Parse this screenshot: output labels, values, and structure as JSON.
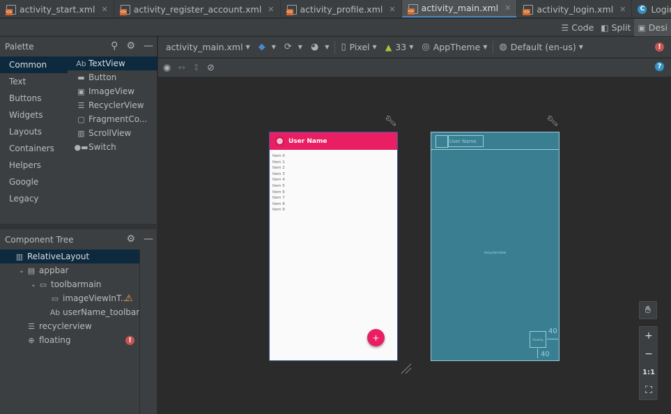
{
  "tabs": [
    {
      "label": "activity_start.xml",
      "type": "xml",
      "active": false
    },
    {
      "label": "activity_register_account.xml",
      "type": "xml",
      "active": false
    },
    {
      "label": "activity_profile.xml",
      "type": "xml",
      "active": false
    },
    {
      "label": "activity_main.xml",
      "type": "xml",
      "active": true
    },
    {
      "label": "activity_login.xml",
      "type": "xml",
      "active": false
    },
    {
      "label": "LoginActivity.java",
      "type": "java",
      "active": false
    }
  ],
  "modes": {
    "code": "Code",
    "split": "Split",
    "design": "Desi"
  },
  "palette": {
    "title": "Palette",
    "categories": [
      "Common",
      "Text",
      "Buttons",
      "Widgets",
      "Layouts",
      "Containers",
      "Helpers",
      "Google",
      "Legacy"
    ],
    "items": [
      {
        "label": "TextView",
        "icon": "Ab"
      },
      {
        "label": "Button",
        "icon": "▬"
      },
      {
        "label": "ImageView",
        "icon": "▣"
      },
      {
        "label": "RecyclerView",
        "icon": "☰"
      },
      {
        "label": "FragmentCo...",
        "icon": "▢"
      },
      {
        "label": "ScrollView",
        "icon": "▥"
      },
      {
        "label": "Switch",
        "icon": "●▬"
      }
    ]
  },
  "component_tree": {
    "title": "Component Tree",
    "items": [
      {
        "label": "RelativeLayout",
        "indent": 0,
        "chev": "",
        "icon": "▥",
        "status": ""
      },
      {
        "label": "appbar",
        "indent": 1,
        "chev": "⌄",
        "icon": "▤",
        "status": ""
      },
      {
        "label": "toolbarmain",
        "indent": 2,
        "chev": "⌄",
        "icon": "▭",
        "status": ""
      },
      {
        "label": "imageViewInT...",
        "indent": 3,
        "chev": "",
        "icon": "▭",
        "status": "warning"
      },
      {
        "label": "userName_toolbar",
        "indent": 3,
        "chev": "",
        "icon": "Ab",
        "status": ""
      },
      {
        "label": "recyclerview",
        "indent": 1,
        "chev": "",
        "icon": "☰",
        "status": ""
      },
      {
        "label": "floating",
        "indent": 1,
        "chev": "",
        "icon": "⊕",
        "status": "error"
      }
    ]
  },
  "design_toolbar": {
    "file": "activity_main.xml",
    "device": "Pixel",
    "api": "33",
    "theme": "AppTheme",
    "locale": "Default (en-us)"
  },
  "preview": {
    "username": "User Name",
    "list_items": [
      "Item 0",
      "Item 1",
      "Item 2",
      "Item 3",
      "Item 4",
      "Item 5",
      "Item 6",
      "Item 7",
      "Item 8",
      "Item 9"
    ],
    "fab_symbol": "+"
  },
  "blueprint": {
    "username": "User Name",
    "recycler_label": "recyclerview",
    "fab_label": "floating",
    "margin_end": "40",
    "margin_bottom": "40"
  },
  "zoom": {
    "fit_label": "1:1"
  },
  "colors": {
    "accent_pink": "#e91e63",
    "blueprint": "#3a7e91",
    "selection": "#0d293e"
  }
}
